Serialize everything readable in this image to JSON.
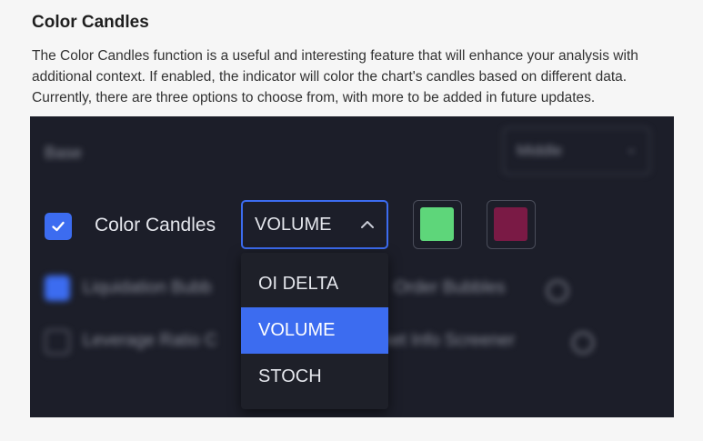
{
  "doc": {
    "title": "Color Candles",
    "body": "The Color Candles function is a useful and interesting feature that will enhance your analysis with additional context. If enabled, the indicator will color the chart's candles based on different data. Currently, there are three options to choose from, with more to be added in future updates."
  },
  "screenshot": {
    "base_label": "Base",
    "base_select_value": "Middle",
    "color_candles": {
      "label": "Color Candles",
      "checked": true,
      "selected": "VOLUME",
      "options": [
        "OI DELTA",
        "VOLUME",
        "STOCH"
      ],
      "bull_color": "#5ed67a",
      "bear_color": "#7a1a45"
    },
    "row3": {
      "left_text": "Liquidation Bubb",
      "right_text": "Order Bubbles"
    },
    "row4": {
      "left_text": "Leverage Ratio C",
      "right_text": "rket Info Screener"
    }
  },
  "colors": {
    "accent": "#3c6cf0",
    "panel_bg": "#1c1e29",
    "page_bg": "#f6f6f6"
  }
}
